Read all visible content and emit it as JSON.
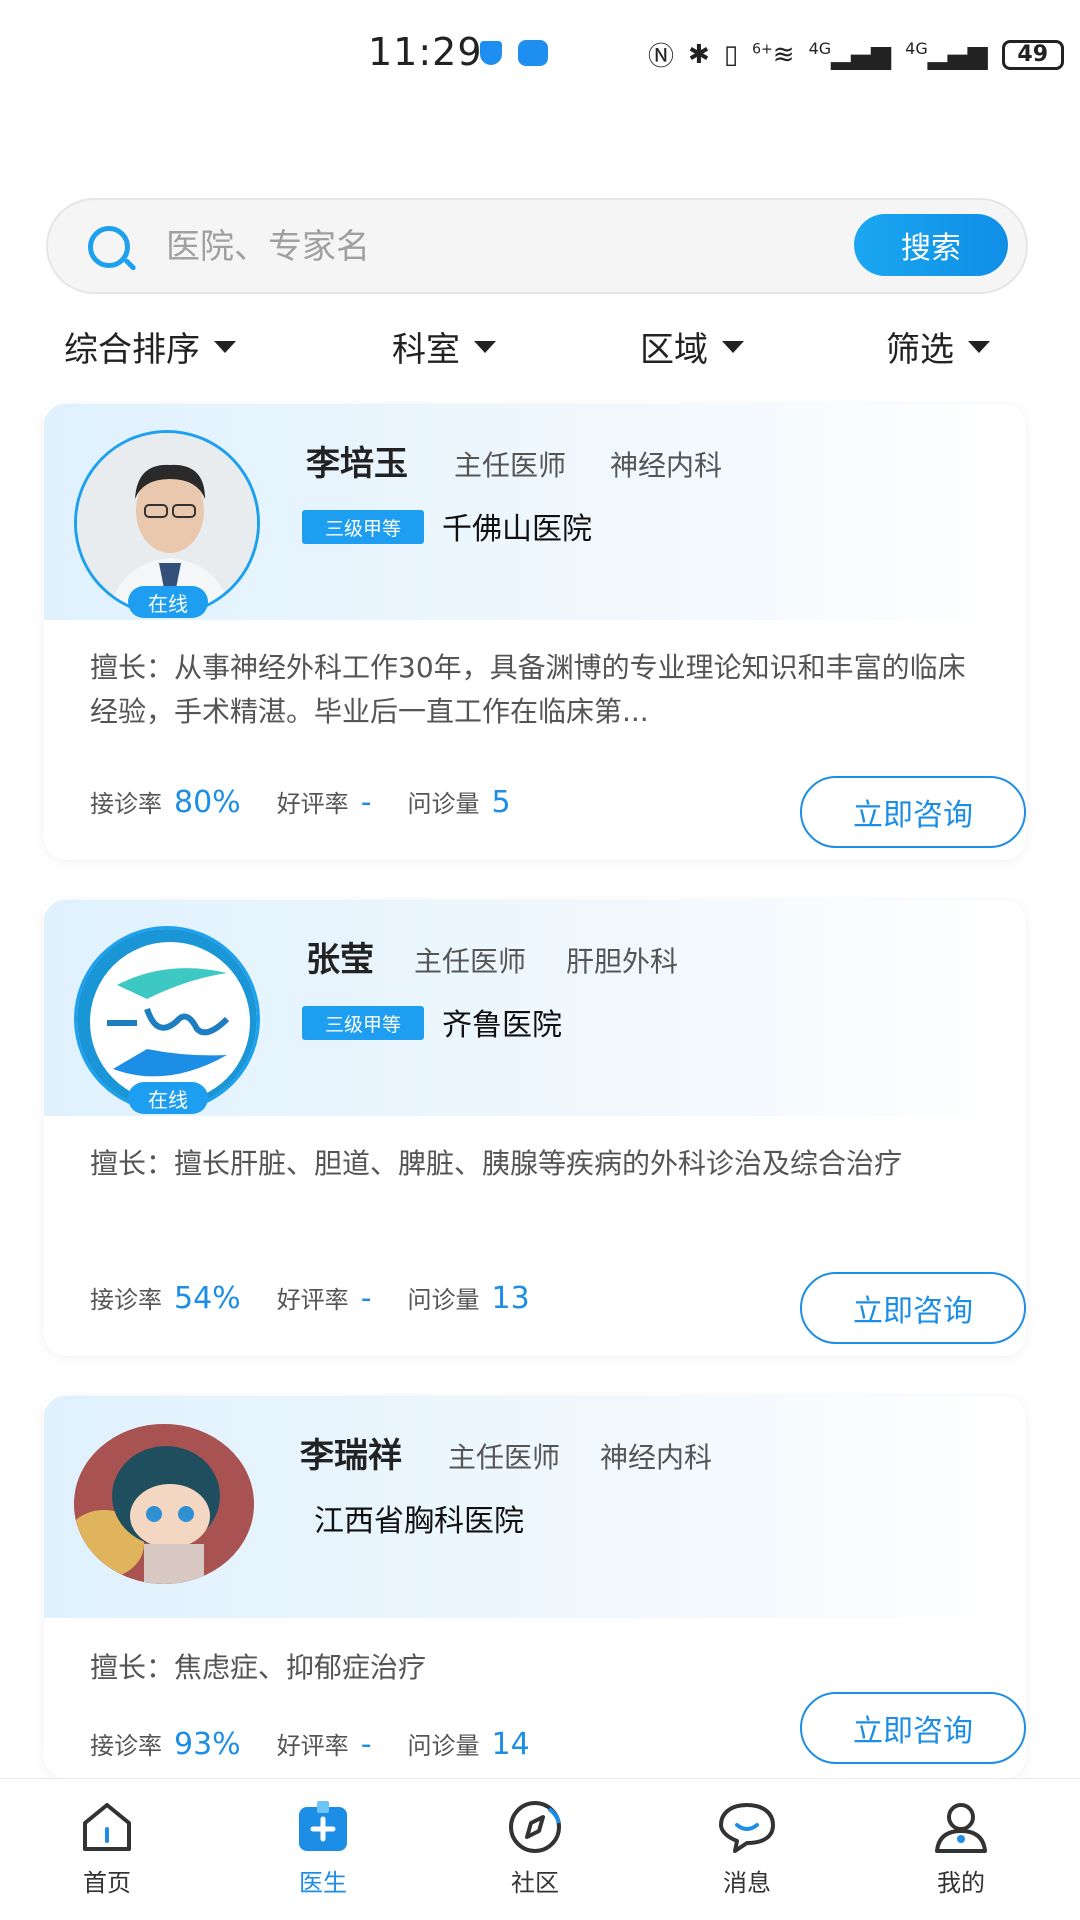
{
  "status_bar": {
    "time": "11:29",
    "battery": "49",
    "network_1": "4G",
    "network_2": "4G",
    "wifi_label": "6+"
  },
  "search": {
    "placeholder": "医院、专家名",
    "button_label": "搜索"
  },
  "filters": [
    {
      "label": "综合排序"
    },
    {
      "label": "科室"
    },
    {
      "label": "区域"
    },
    {
      "label": "筛选"
    }
  ],
  "doctors": [
    {
      "name": "李培玉",
      "title": "主任医师",
      "department": "神经内科",
      "grade": "三级甲等",
      "hospital": "千佛山医院",
      "online": "在线",
      "specialty": "擅长：从事神经外科工作30年，具备渊博的专业理论知识和丰富的临床经验，手术精湛。毕业后一直工作在临床第...",
      "accept_rate_label": "接诊率",
      "accept_rate": "80%",
      "praise_rate_label": "好评率",
      "praise_rate": "-",
      "consult_count_label": "问诊量",
      "consult_count": "5",
      "button_label": "立即咨询"
    },
    {
      "name": "张莹",
      "title": "主任医师",
      "department": "肝胆外科",
      "grade": "三级甲等",
      "hospital": "齐鲁医院",
      "online": "在线",
      "specialty": "擅长：擅长肝脏、胆道、脾脏、胰腺等疾病的外科诊治及综合治疗",
      "accept_rate_label": "接诊率",
      "accept_rate": "54%",
      "praise_rate_label": "好评率",
      "praise_rate": "-",
      "consult_count_label": "问诊量",
      "consult_count": "13",
      "button_label": "立即咨询"
    },
    {
      "name": "李瑞祥",
      "title": "主任医师",
      "department": "神经内科",
      "grade": "",
      "hospital": "江西省胸科医院",
      "online": "",
      "specialty": "擅长：焦虑症、抑郁症治疗",
      "accept_rate_label": "接诊率",
      "accept_rate": "93%",
      "praise_rate_label": "好评率",
      "praise_rate": "-",
      "consult_count_label": "问诊量",
      "consult_count": "14",
      "button_label": "立即咨询"
    }
  ],
  "bottom_nav": [
    {
      "label": "首页",
      "icon": "home-icon"
    },
    {
      "label": "医生",
      "icon": "doctor-icon"
    },
    {
      "label": "社区",
      "icon": "compass-icon"
    },
    {
      "label": "消息",
      "icon": "message-icon"
    },
    {
      "label": "我的",
      "icon": "profile-icon"
    }
  ],
  "colors": {
    "accent": "#1d8ee6",
    "accent_light": "#1da1ee",
    "card_head_bg": "#dff1fd"
  }
}
